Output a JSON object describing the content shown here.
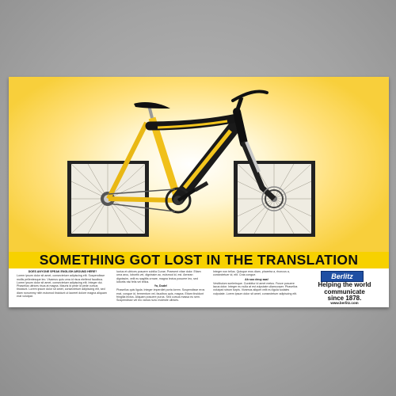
{
  "poster": {
    "headline": "SOMETHING GOT LOST IN THE TRANSLATION",
    "brand": "Berlitz",
    "tagline_lines": [
      "Helping the world",
      "communicate",
      "since 1878."
    ],
    "website": "www.berlitz.com",
    "columns": [
      {
        "heading": "DOES ANYONE SPEAK ENGLISH AROUND HERE?",
        "text": "Lorem ipsum dolor sit amet, consectetuer adipiscing elit. Suspendisse mollis pellentesque leo. Vivamus quis urna id risus eleifend faucibus. Lorem ipsum dolor sit amet, consectetuer adipiscing elit. Integer dui. Phasellus ultrices risus at magna. Mauris id pede id pede cursus tincidunt. Lorem ipsum dolor sit amet, consectetuer adipiscing elit, sed diam nonummy nibh euismod tincidunt ut laoreet dolore magna aliquam erat volutpat."
      },
      {
        "text1": "luctus et ultrices posuere cubilia Curae; Praesent vitae dolor. Etiam urna arcu, lobortis vel, dignissim ac, euismod id, est. Aenean dignissim, velit eu sagittis ornare, magna lectus posuere leo, sed lobortis nisi felis vel tellus.",
        "subhead": "Yo, Dude!",
        "text2": "Phasellus quis ligula. Integer imperdiet porta lorem. Suspendisse eros erat, congue id, fermentum vel, faucibus quis, magna. Etiam tincidunt fringilla lectus. Aliquam posuere purus. Sed cursus massa eu sem. Suspendisse vel leo varius nunc molestie ultrices."
      },
      {
        "text1": "Integer non tellus. Quisque eros diam, pharetra a, rhoncus a, consectetuer id, elit. Cras congue.",
        "subhead": "Ah soo deuy aaa!",
        "text2": "Vestibulum scelerisque. Curabitur id amet metus. Fusce posuere lacus dolor. Integer eu nulla at est vulputate ullamcorper. Phasellus volutpat rutrum turpis. Vivamus aliquet velit eu ligula sodales vulputate. Lorem ipsum dolor sit amet, consectetuer adipiscing elit."
      }
    ]
  },
  "colors": {
    "frame_yellow": "#f3c51c",
    "frame_black": "#111111",
    "headline_bar": "#f7d100",
    "brand_blue": "#1f4fa3"
  }
}
